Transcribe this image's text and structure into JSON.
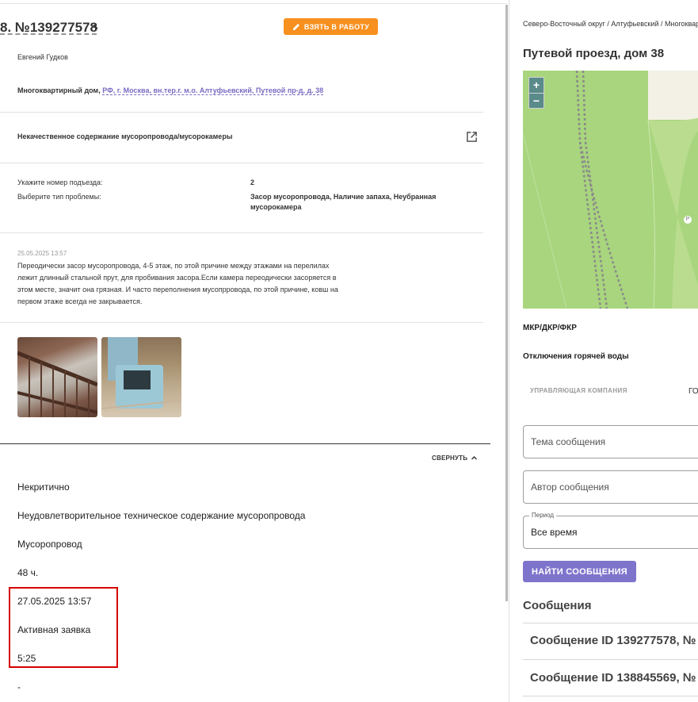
{
  "request": {
    "title": "8. №139277578",
    "take_button": "ВЗЯТЬ В РАБОТУ",
    "author": "Евгений Гудков",
    "building_type": "Многоквартирный дом,",
    "address": "РФ, г. Москва, вн.тер.г. м.о. Алтуфьевский, Путевой пр-д, д. 38",
    "issue": "Некачественное содержание мусоропровода/мусорокамеры",
    "fields": [
      {
        "label": "Укажите номер подъезда:",
        "value": "2"
      },
      {
        "label": "Выберите тип проблемы:",
        "value": "Засор мусоропровода, Наличие запаха, Неубранная мусорокамера"
      }
    ],
    "comment_date": "25.05.2025 13:57",
    "comment_text": "Переодически засор мусоропровода, 4-5 этаж, по этой причине между этажами на перелилах лежит длинный стальной прут, для пробивания засора.Если камера переодически засоряется в этом месте, значит она грязная. И часто переполнения мусопрровода, по этой причине, ковш на первом этаже всегда не закрывается.",
    "collapse_label": "СВЕРНУТЬ",
    "details": [
      "Некритично",
      "Неудовлетворительное техническое содержание мусоропровода",
      "Мусоропровод",
      "48 ч.",
      "27.05.2025 13:57",
      "Активная заявка",
      "5:25",
      "-"
    ]
  },
  "side": {
    "breadcrumb": "Северо-Восточный округ / Алтуфьевский / Многоквартирный дом",
    "address_title": "Путевой проезд, дом 38",
    "map": {
      "zoom_in": "+",
      "zoom_out": "−",
      "poi": "P"
    },
    "mkr_label": "МКР/ДКР/ФКР",
    "hot_water_label": "Отключения горячей воды",
    "mc_label": "УПРАВЛЯЮЩАЯ КОМПАНИЯ",
    "mc_value": "ГО",
    "subject_placeholder": "Тема сообщения",
    "author_placeholder": "Автор сообщения",
    "period_label": "Период",
    "period_value": "Все время",
    "find_button": "НАЙТИ СООБЩЕНИЯ",
    "messages_title": "Сообщения",
    "messages": [
      "Сообщение ID 139277578, №",
      "Сообщение ID 138845569, №"
    ]
  },
  "colors": {
    "accent_orange": "#f7901e",
    "accent_purple": "#7f74cc",
    "link": "#7a6cc4",
    "highlight": "#d50000",
    "map_green": "#a8d57d"
  }
}
